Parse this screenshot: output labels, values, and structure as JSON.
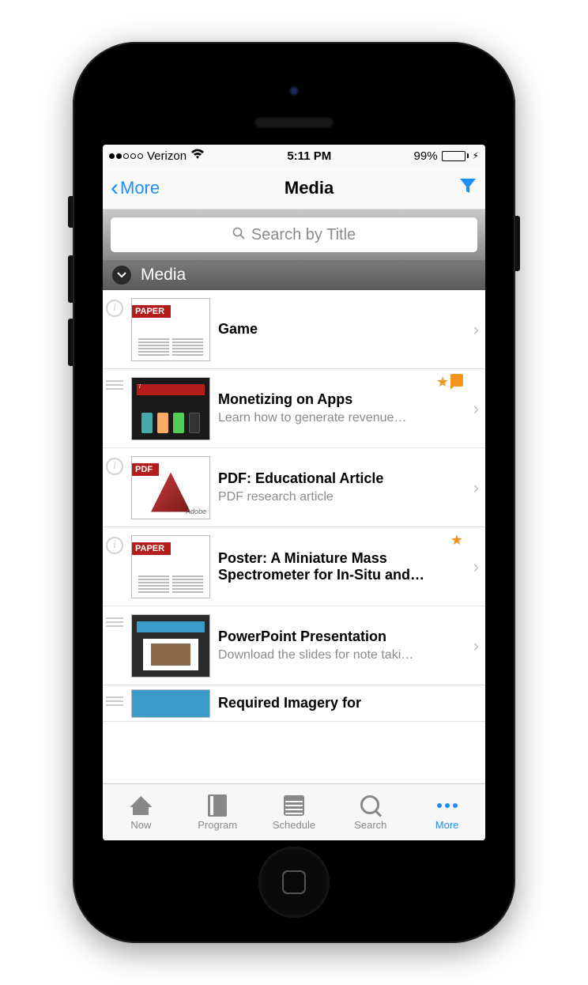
{
  "status": {
    "carrier": "Verizon",
    "time": "5:11 PM",
    "battery": "99%"
  },
  "navbar": {
    "back": "More",
    "title": "Media"
  },
  "search": {
    "placeholder": "Search by Title"
  },
  "section": {
    "title": "Media"
  },
  "items": [
    {
      "title": "Game",
      "subtitle": "",
      "thumb_type": "paper",
      "thumb_tag": "PAPER",
      "left_icon": "info",
      "star": false,
      "note": false
    },
    {
      "title": "Monetizing on Apps",
      "subtitle": "Learn how to generate revenue…",
      "thumb_type": "dark",
      "thumb_tag": "",
      "left_icon": "hamburger",
      "star": true,
      "note": true
    },
    {
      "title": "PDF: Educational Article",
      "subtitle": "PDF research article",
      "thumb_type": "pdf",
      "thumb_tag": "PDF",
      "left_icon": "info",
      "star": false,
      "note": false
    },
    {
      "title": "Poster: A Miniature Mass Spectrometer for In-Situ and…",
      "subtitle": "",
      "thumb_type": "paper",
      "thumb_tag": "PAPER",
      "left_icon": "info",
      "star": true,
      "note": false
    },
    {
      "title": "PowerPoint Presentation",
      "subtitle": "Download the slides for note taki…",
      "thumb_type": "slide",
      "thumb_tag": "",
      "left_icon": "hamburger",
      "star": false,
      "note": false
    },
    {
      "title": "Required Imagery for",
      "subtitle": "",
      "thumb_type": "banner",
      "thumb_tag": "",
      "left_icon": "hamburger",
      "star": false,
      "note": false
    }
  ],
  "tabs": [
    {
      "label": "Now",
      "icon": "house",
      "active": false
    },
    {
      "label": "Program",
      "icon": "book",
      "active": false
    },
    {
      "label": "Schedule",
      "icon": "cal",
      "active": false
    },
    {
      "label": "Search",
      "icon": "mag",
      "active": false
    },
    {
      "label": "More",
      "icon": "dots",
      "active": true
    }
  ]
}
